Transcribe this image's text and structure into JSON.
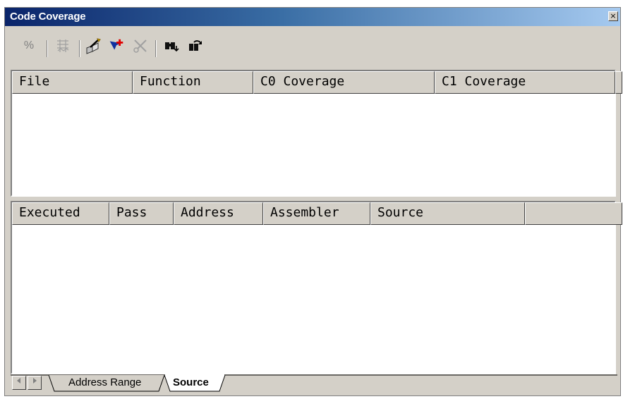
{
  "window": {
    "title": "Code Coverage",
    "close_glyph": "×"
  },
  "toolbar": {
    "buttons": [
      {
        "name": "percent-button",
        "glyph": "%",
        "enabled": false
      },
      {
        "name": "range-button",
        "icon": "grid-icon",
        "enabled": false
      },
      {
        "name": "setup-button",
        "icon": "wand-icon",
        "enabled": true
      },
      {
        "name": "add-range-button",
        "icon": "add-arrow-icon",
        "enabled": true
      },
      {
        "name": "remove-range-button",
        "icon": "remove-icon",
        "enabled": false
      },
      {
        "name": "find-button",
        "icon": "binoculars-icon",
        "enabled": true
      },
      {
        "name": "refresh-button",
        "icon": "refresh-icon",
        "enabled": true
      }
    ]
  },
  "upper_table": {
    "columns": [
      "File",
      "Function",
      "C0 Coverage",
      "C1 Coverage"
    ],
    "rows": []
  },
  "lower_table": {
    "columns": [
      "Executed",
      "Pass",
      "Address",
      "Assembler",
      "Source"
    ],
    "rows": []
  },
  "tabs": [
    {
      "label": "Address Range",
      "active": false
    },
    {
      "label": "Source",
      "active": true
    }
  ],
  "colors": {
    "title_start": "#0a246a",
    "title_end": "#a6caf0",
    "face": "#d4d0c8"
  }
}
